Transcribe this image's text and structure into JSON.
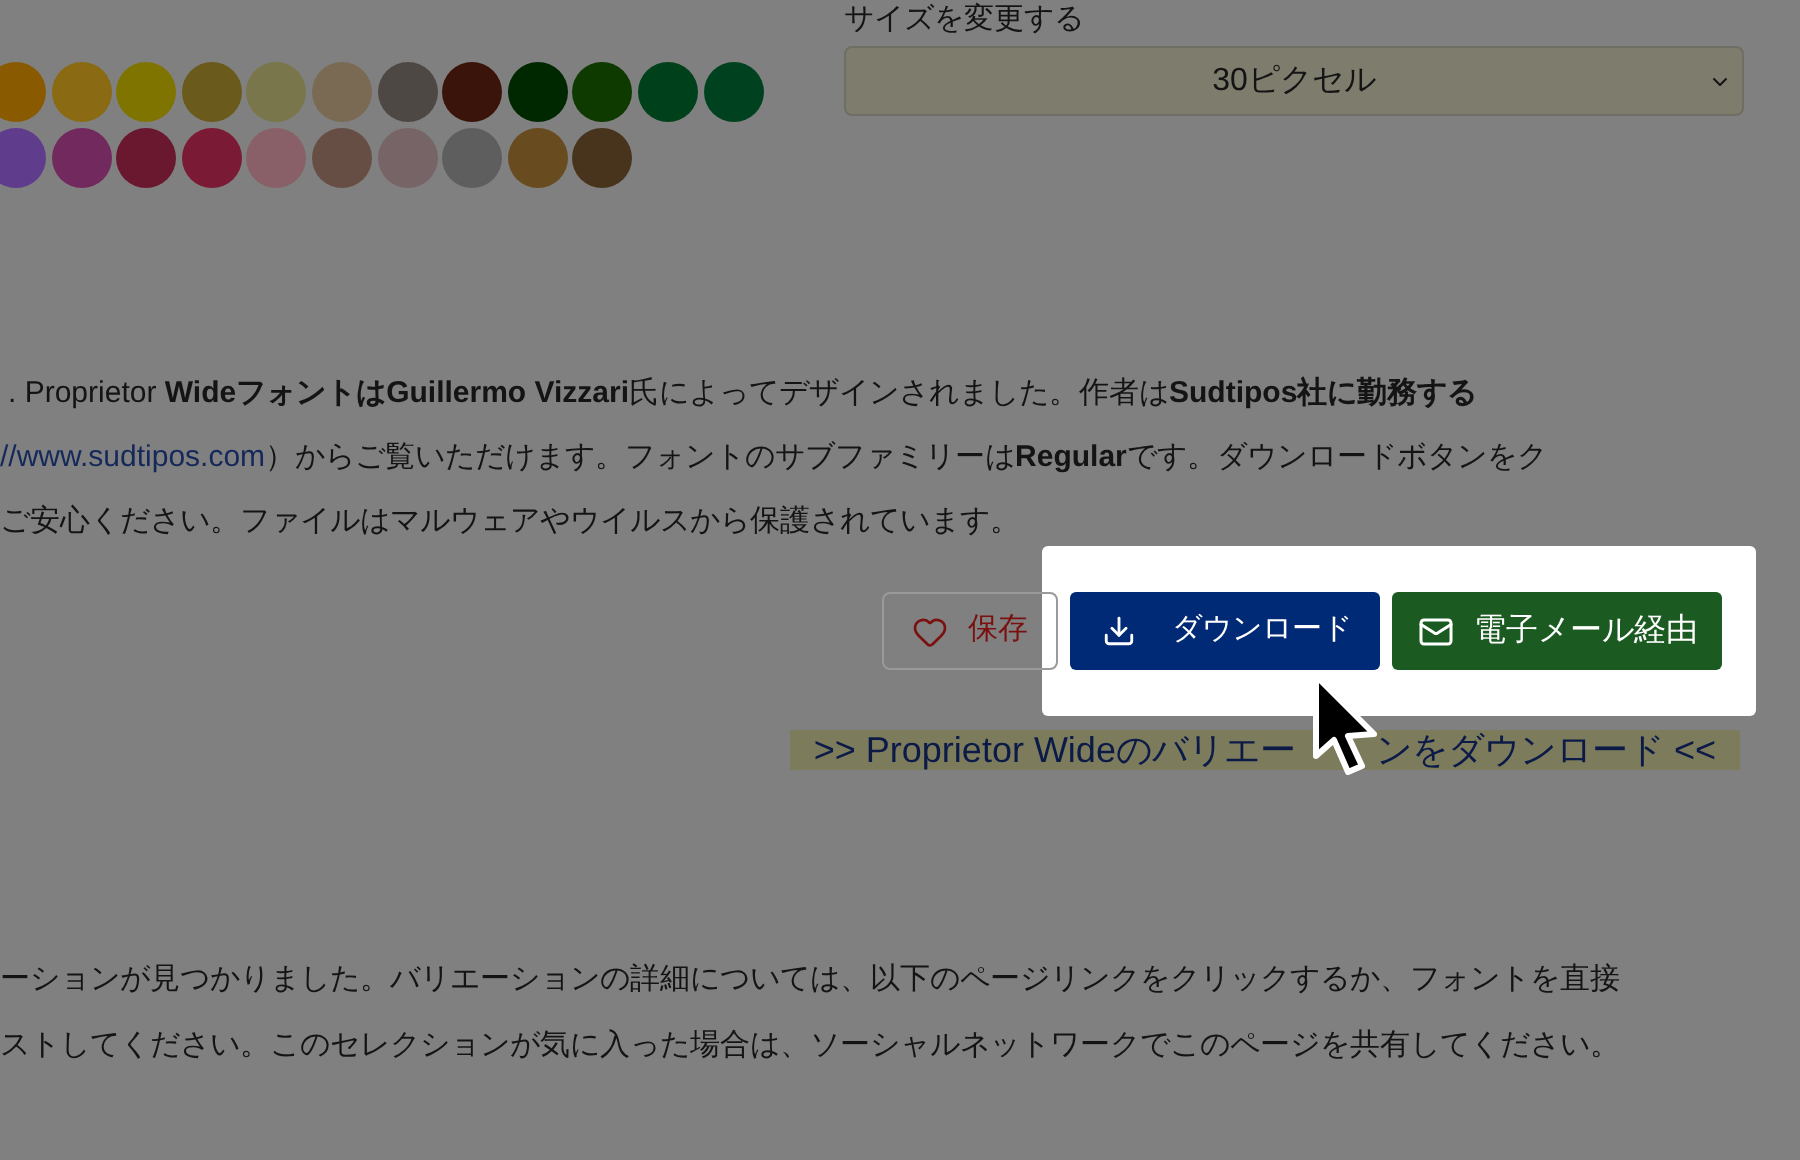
{
  "swatches": [
    {
      "color": "#8a5a00"
    },
    {
      "color": "#8a6a12"
    },
    {
      "color": "#807400"
    },
    {
      "color": "#6a5a1c"
    },
    {
      "color": "#7a764c"
    },
    {
      "color": "#7a6a54"
    },
    {
      "color": "#4e4844"
    },
    {
      "color": "#3a140a"
    },
    {
      "color": "#002800"
    },
    {
      "color": "#0e3a00"
    },
    {
      "color": "#00401a"
    },
    {
      "color": "#004220"
    },
    {
      "color": "#603c8c"
    },
    {
      "color": "#722a5e"
    },
    {
      "color": "#6a1830"
    },
    {
      "color": "#7a1a34"
    },
    {
      "color": "#8a6068"
    },
    {
      "color": "#664e44"
    },
    {
      "color": "#766466"
    },
    {
      "color": "#5e5e5e"
    },
    {
      "color": "#684c20"
    },
    {
      "color": "#48341c"
    }
  ],
  "size_select": {
    "label": "サイズを変更する",
    "value": "30ピクセル"
  },
  "description": {
    "lines": [
      ". Proprietor **Wideフォントは****Guillermo Vizzari**氏によってデザインされました。作者は**Sudtipos社に勤務する**",
      {
        "link": "//www.sudtipos.com",
        "text": "）からご覧いただけます。フォントのサブファミリーは**Regular**です。ダウンロードボタンをク"
      },
      "ご安心ください。ファイルはマルウェアやウイルスから保護されています。"
    ]
  },
  "actions": {
    "save": "保存",
    "download": "ダウンロード",
    "email": "電子メール経由"
  },
  "variations_link": [
    ">> Proprietor Wideのバリエー",
    "ンをダウンロード <<"
  ],
  "variations_text": [
    "ーションが見つかりました。バリエーションの詳細については、以下のページリンクをクリックするか、フォントを直接",
    "ストしてください。このセレクションが気に入った場合は、ソーシャルネットワークでこのページを共有してください。"
  ]
}
